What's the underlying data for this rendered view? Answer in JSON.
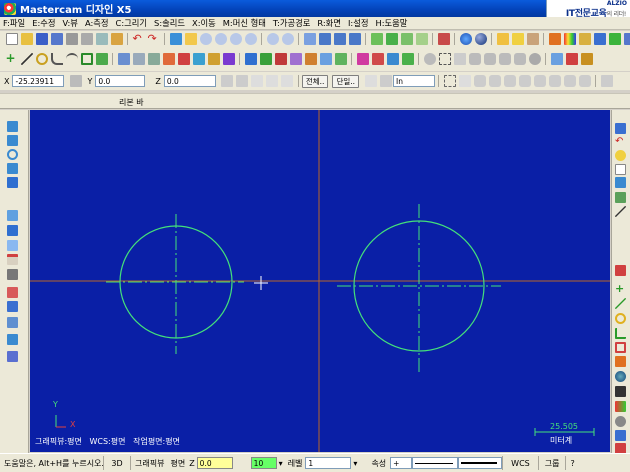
{
  "title": "Mastercam 디자인 X5",
  "brand": {
    "top": "ALZIO",
    "main": "IT전문교육",
    "sub": "의 리더!"
  },
  "menu": [
    "F:파일",
    "E:수정",
    "V:뷰",
    "A:측정",
    "C:그리기",
    "S:솔리드",
    "X:이동",
    "M:머신 형태",
    "T:가공경로",
    "R:화면",
    "I:설정",
    "H:도움말"
  ],
  "coords": {
    "x_label": "X",
    "x_value": "-25.23911",
    "y_label": "Y",
    "y_value": "0.0",
    "z_label": "Z",
    "z_value": "0.0"
  },
  "buttons": {
    "all": "전체..",
    "single": "단일..",
    "unit": "In"
  },
  "ribbon_label": "리본 바",
  "canvas": {
    "view_info": "그래픽뷰:평면   WCS:평면   작업평면:평면",
    "axis_y": "Y",
    "axis_x": "X",
    "scale_value": "25.505",
    "scale_unit": "미터계"
  },
  "status": {
    "help_text": "도움말은, Alt+H를 누르시오.",
    "mode": "3D",
    "gview_label": "그래픽뷰",
    "plane_label": "평면",
    "z_label": "Z",
    "z_value": "0.0",
    "color_value": "10",
    "level_label": "레벨",
    "level_value": "1",
    "attr_label": "속성",
    "wcs_label": "WCS",
    "group_label": "그룹",
    "help_q": "?"
  },
  "colors": {
    "canvas_bg": "#0a1fa6",
    "circle": "#44e17a",
    "axis_line": "#c06a2a",
    "titlebar": "#0846c4"
  }
}
